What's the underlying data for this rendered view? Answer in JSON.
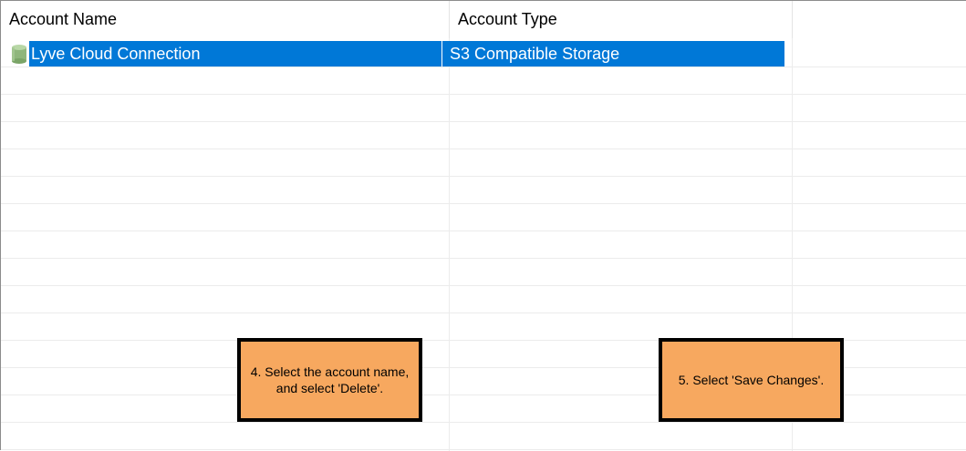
{
  "table": {
    "columns": [
      "Account Name",
      "Account Type"
    ],
    "rows": [
      {
        "account_name": "Lyve Cloud Connection",
        "account_type": "S3 Compatible Storage",
        "selected": true,
        "icon": "storage-cylinder-icon"
      }
    ]
  },
  "callouts": [
    {
      "text": "4. Select the account name, and select 'Delete'."
    },
    {
      "text": "5. Select 'Save Changes'."
    }
  ],
  "colors": {
    "selection": "#0078d7",
    "callout_fill": "#f7a85f",
    "callout_border": "#000000"
  }
}
